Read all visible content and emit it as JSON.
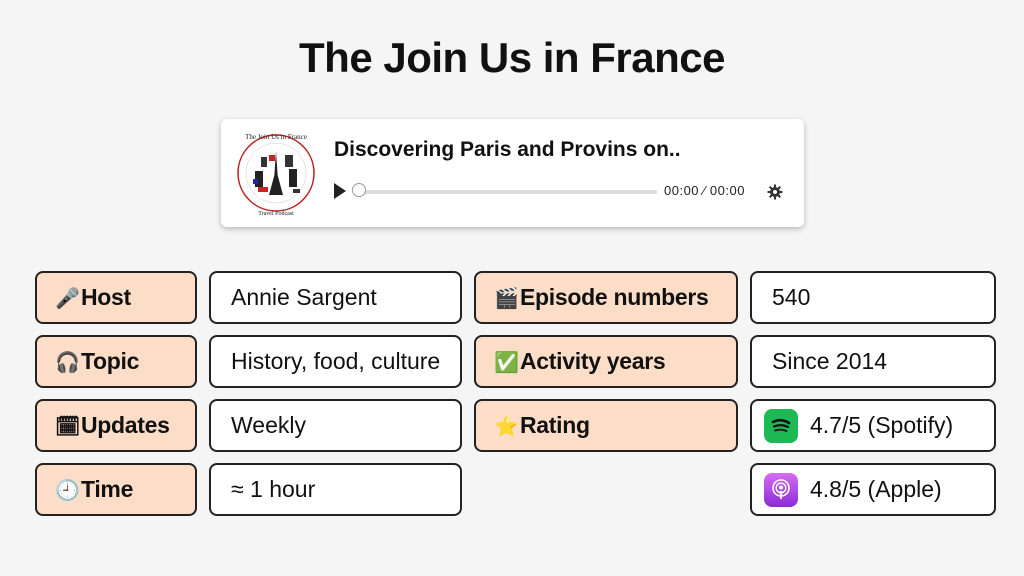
{
  "page": {
    "title": "The Join Us in France"
  },
  "player": {
    "cover_title": "The Join Us in France",
    "cover_subtitle": "Travel Podcast",
    "episode_title": "Discovering Paris and Provins on..",
    "time_display": "00:00 ⁄ 00:00",
    "progress_fraction": 0
  },
  "info": {
    "host": {
      "icon": "microphone-icon",
      "emoji": "🎤",
      "label": "Host",
      "value": "Annie Sargent"
    },
    "topic": {
      "icon": "headphones-icon",
      "emoji": "🎧",
      "label": "Topic",
      "value": "History, food, culture"
    },
    "updates": {
      "icon": "calendar-icon",
      "emoji": "🗓",
      "label": "Updates",
      "value": "Weekly"
    },
    "time": {
      "icon": "clock-icon",
      "emoji": "🕘",
      "label": "Time",
      "value": "≈ 1 hour"
    },
    "episodes": {
      "icon": "clapper-board-icon",
      "emoji": "🎬",
      "label": "Episode numbers",
      "value": "540"
    },
    "activity": {
      "icon": "check-mark-icon",
      "emoji": "✅",
      "label": "Activity years",
      "value": "Since 2014"
    },
    "rating": {
      "icon": "star-icon",
      "emoji": "⭐",
      "label": "Rating"
    },
    "spotify": {
      "icon": "spotify-icon",
      "value": "4.7/5 (Spotify)",
      "color": "#1db954"
    },
    "apple": {
      "icon": "apple-podcasts-icon",
      "value": "4.8/5 (Apple)",
      "color": "#a93ee0"
    }
  },
  "colors": {
    "label_bg": "#fcdec8",
    "value_bg": "#ffffff",
    "border": "#222222"
  }
}
